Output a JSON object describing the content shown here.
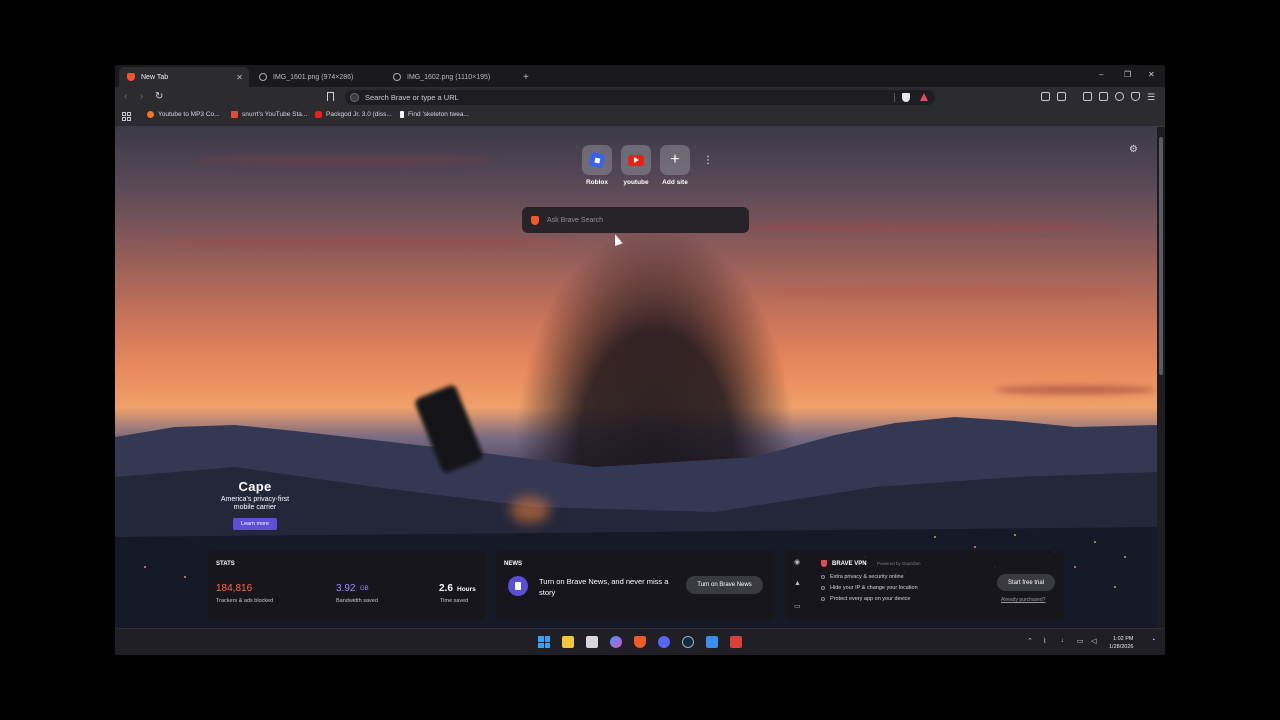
{
  "browser": {
    "tabs": [
      {
        "label": "New Tab",
        "active": true
      },
      {
        "label": "IMG_1601.png (974×286)",
        "active": false
      },
      {
        "label": "IMG_1602.png (1110×195)",
        "active": false
      }
    ],
    "new_tab_symbol": "+",
    "window_controls": [
      "–",
      "❐",
      "✕"
    ],
    "address_placeholder": "Search Brave or type a URL",
    "bookmarks": [
      {
        "label": "Youtube to MP3 Co...",
        "icon": "orange-circle-icon",
        "color": "#f0782a"
      },
      {
        "label": "snurrt's YouTube Sta...",
        "icon": "chart-icon",
        "color": "#e24a3a"
      },
      {
        "label": "Packgod Jr. 3.0 (diss...",
        "icon": "youtube-icon",
        "color": "#e62117"
      },
      {
        "label": "Find 'skeleton twea...",
        "icon": "tiktok-icon",
        "color": "#ffffff"
      }
    ]
  },
  "ntp": {
    "top_sites": [
      {
        "label": "Roblox",
        "icon": "roblox-icon"
      },
      {
        "label": "youtube",
        "icon": "youtube-icon"
      },
      {
        "label": "Add site",
        "icon": "plus-icon"
      }
    ],
    "search_placeholder": "Ask Brave Search",
    "ad": {
      "brand": "Cape",
      "tagline": "America's privacy-first mobile carrier",
      "cta": "Learn more"
    },
    "stats": {
      "title": "STATS",
      "trackers_value": "184,816",
      "trackers_label": "Trackers & ads blocked",
      "bandwidth_value": "3.92",
      "bandwidth_unit": "GB",
      "bandwidth_label": "Bandwidth saved",
      "time_value": "2.6",
      "time_unit": "Hours",
      "time_label": "Time saved",
      "trackers_color": "#ff6a3d",
      "bandwidth_color": "#9b8cff"
    },
    "news": {
      "title": "NEWS",
      "text": "Turn on Brave News, and never miss a story",
      "button": "Turn on Brave News"
    },
    "vpn": {
      "title": "BRAVE VPN",
      "powered": "Powered by Guardian",
      "features": [
        "Extra privacy & security online",
        "Hide your IP & change your location",
        "Protect every app on your device"
      ],
      "button": "Start free trial",
      "link": "Already purchased?"
    }
  },
  "taskbar": {
    "time": "1:02 PM",
    "date": "1/28/2026"
  }
}
